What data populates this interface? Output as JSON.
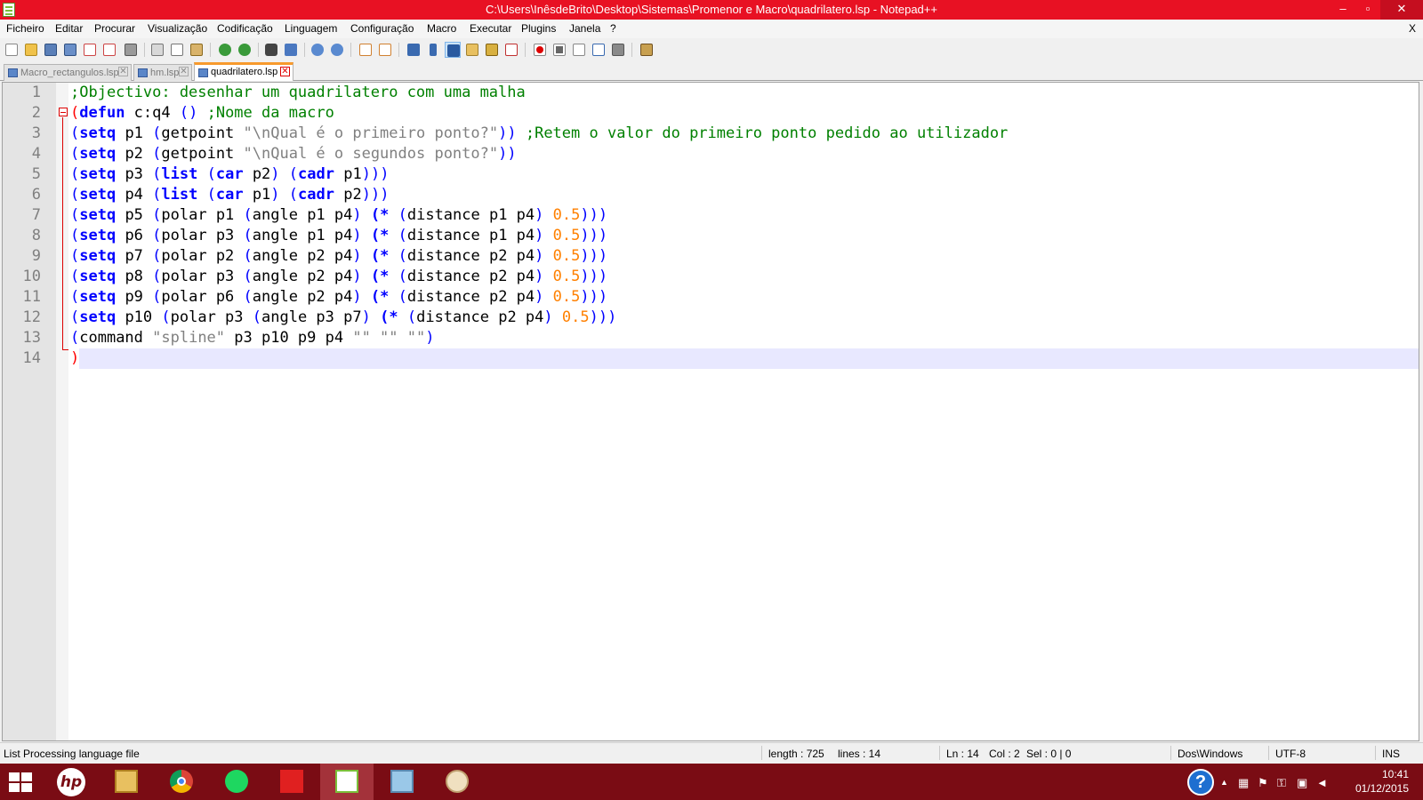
{
  "window": {
    "title": "C:\\Users\\InêsdeBrito\\Desktop\\Sistemas\\Promenor e Macro\\quadrilatero.lsp - Notepad++",
    "minimize_glyph": "–",
    "maximize_glyph": "▫",
    "close_glyph": "✕",
    "menu_close": "X"
  },
  "menu": {
    "items": [
      "Ficheiro",
      "Editar",
      "Procurar",
      "Visualização",
      "Codificação",
      "Linguagem",
      "Configuração",
      "Macro",
      "Executar",
      "Plugins",
      "Janela",
      "?"
    ]
  },
  "toolbar": {
    "icons": [
      "new-file-icon",
      "open-file-icon",
      "save-icon",
      "save-all-icon",
      "close-icon",
      "close-all-icon",
      "print-icon",
      "cut-icon",
      "copy-icon",
      "paste-icon",
      "undo-icon",
      "redo-icon",
      "find-icon",
      "replace-icon",
      "zoom-in-icon",
      "zoom-out-icon",
      "sync-vertical-icon",
      "sync-horizontal-icon",
      "word-wrap-icon",
      "show-all-chars-icon",
      "indent-guide-icon",
      "doc-map-icon",
      "function-list-icon",
      "folder-workspace-icon",
      "record-macro-icon",
      "stop-record-icon",
      "play-macro-icon",
      "run-macro-multiple-icon",
      "save-macro-icon",
      "launch-browser-icon"
    ]
  },
  "tabs": [
    {
      "label": "Macro_rectangulos.lsp",
      "close": "✕",
      "active": false
    },
    {
      "label": "hm.lsp",
      "close": "✕",
      "active": false
    },
    {
      "label": "quadrilatero.lsp",
      "close": "✕",
      "active": true
    }
  ],
  "editor": {
    "line_numbers": [
      "1",
      "2",
      "3",
      "4",
      "5",
      "6",
      "7",
      "8",
      "9",
      "10",
      "11",
      "12",
      "13",
      "14"
    ],
    "lines": [
      [
        {
          "t": ";Objectivo: desenhar um quadrilatero com uma malha",
          "c": "cm"
        }
      ],
      [
        {
          "t": "(",
          "c": "rd"
        },
        {
          "t": "defun",
          "c": "kw"
        },
        {
          "t": " c:q4 ",
          "c": ""
        },
        {
          "t": "()",
          "c": "pn"
        },
        {
          "t": " ",
          "c": ""
        },
        {
          "t": ";Nome da macro",
          "c": "cm"
        }
      ],
      [
        {
          "t": "(",
          "c": "pn"
        },
        {
          "t": "setq",
          "c": "kw"
        },
        {
          "t": " p1 ",
          "c": ""
        },
        {
          "t": "(",
          "c": "pn"
        },
        {
          "t": "getpoint ",
          "c": ""
        },
        {
          "t": "\"\\nQual é o primeiro ponto?\"",
          "c": "st"
        },
        {
          "t": "))",
          "c": "pn"
        },
        {
          "t": " ",
          "c": ""
        },
        {
          "t": ";Retem o valor do primeiro ponto pedido ao utilizador",
          "c": "cm"
        }
      ],
      [
        {
          "t": "(",
          "c": "pn"
        },
        {
          "t": "setq",
          "c": "kw"
        },
        {
          "t": " p2 ",
          "c": ""
        },
        {
          "t": "(",
          "c": "pn"
        },
        {
          "t": "getpoint ",
          "c": ""
        },
        {
          "t": "\"\\nQual é o segundos ponto?\"",
          "c": "st"
        },
        {
          "t": "))",
          "c": "pn"
        }
      ],
      [
        {
          "t": "(",
          "c": "pn"
        },
        {
          "t": "setq",
          "c": "kw"
        },
        {
          "t": " p3 ",
          "c": ""
        },
        {
          "t": "(",
          "c": "pn"
        },
        {
          "t": "list",
          "c": "kw"
        },
        {
          "t": " ",
          "c": ""
        },
        {
          "t": "(",
          "c": "pn"
        },
        {
          "t": "car",
          "c": "kw"
        },
        {
          "t": " p2",
          "c": ""
        },
        {
          "t": ")",
          "c": "pn"
        },
        {
          "t": " ",
          "c": ""
        },
        {
          "t": "(",
          "c": "pn"
        },
        {
          "t": "cadr",
          "c": "kw"
        },
        {
          "t": " p1",
          "c": ""
        },
        {
          "t": ")))",
          "c": "pn"
        }
      ],
      [
        {
          "t": "(",
          "c": "pn"
        },
        {
          "t": "setq",
          "c": "kw"
        },
        {
          "t": " p4 ",
          "c": ""
        },
        {
          "t": "(",
          "c": "pn"
        },
        {
          "t": "list",
          "c": "kw"
        },
        {
          "t": " ",
          "c": ""
        },
        {
          "t": "(",
          "c": "pn"
        },
        {
          "t": "car",
          "c": "kw"
        },
        {
          "t": " p1",
          "c": ""
        },
        {
          "t": ")",
          "c": "pn"
        },
        {
          "t": " ",
          "c": ""
        },
        {
          "t": "(",
          "c": "pn"
        },
        {
          "t": "cadr",
          "c": "kw"
        },
        {
          "t": " p2",
          "c": ""
        },
        {
          "t": ")))",
          "c": "pn"
        }
      ],
      [
        {
          "t": "(",
          "c": "pn"
        },
        {
          "t": "setq",
          "c": "kw"
        },
        {
          "t": " p5 ",
          "c": ""
        },
        {
          "t": "(",
          "c": "pn"
        },
        {
          "t": "polar p1 ",
          "c": ""
        },
        {
          "t": "(",
          "c": "pn"
        },
        {
          "t": "angle p1 p4",
          "c": ""
        },
        {
          "t": ")",
          "c": "pn"
        },
        {
          "t": " ",
          "c": ""
        },
        {
          "t": "(*",
          "c": "kw"
        },
        {
          "t": " ",
          "c": ""
        },
        {
          "t": "(",
          "c": "pn"
        },
        {
          "t": "distance p1 p4",
          "c": ""
        },
        {
          "t": ")",
          "c": "pn"
        },
        {
          "t": " ",
          "c": ""
        },
        {
          "t": "0.5",
          "c": "nm"
        },
        {
          "t": ")))",
          "c": "pn"
        }
      ],
      [
        {
          "t": "(",
          "c": "pn"
        },
        {
          "t": "setq",
          "c": "kw"
        },
        {
          "t": " p6 ",
          "c": ""
        },
        {
          "t": "(",
          "c": "pn"
        },
        {
          "t": "polar p3 ",
          "c": ""
        },
        {
          "t": "(",
          "c": "pn"
        },
        {
          "t": "angle p1 p4",
          "c": ""
        },
        {
          "t": ")",
          "c": "pn"
        },
        {
          "t": " ",
          "c": ""
        },
        {
          "t": "(*",
          "c": "kw"
        },
        {
          "t": " ",
          "c": ""
        },
        {
          "t": "(",
          "c": "pn"
        },
        {
          "t": "distance p1 p4",
          "c": ""
        },
        {
          "t": ")",
          "c": "pn"
        },
        {
          "t": " ",
          "c": ""
        },
        {
          "t": "0.5",
          "c": "nm"
        },
        {
          "t": ")))",
          "c": "pn"
        }
      ],
      [
        {
          "t": "(",
          "c": "pn"
        },
        {
          "t": "setq",
          "c": "kw"
        },
        {
          "t": " p7 ",
          "c": ""
        },
        {
          "t": "(",
          "c": "pn"
        },
        {
          "t": "polar p2 ",
          "c": ""
        },
        {
          "t": "(",
          "c": "pn"
        },
        {
          "t": "angle p2 p4",
          "c": ""
        },
        {
          "t": ")",
          "c": "pn"
        },
        {
          "t": " ",
          "c": ""
        },
        {
          "t": "(*",
          "c": "kw"
        },
        {
          "t": " ",
          "c": ""
        },
        {
          "t": "(",
          "c": "pn"
        },
        {
          "t": "distance p2 p4",
          "c": ""
        },
        {
          "t": ")",
          "c": "pn"
        },
        {
          "t": " ",
          "c": ""
        },
        {
          "t": "0.5",
          "c": "nm"
        },
        {
          "t": ")))",
          "c": "pn"
        }
      ],
      [
        {
          "t": "(",
          "c": "pn"
        },
        {
          "t": "setq",
          "c": "kw"
        },
        {
          "t": " p8 ",
          "c": ""
        },
        {
          "t": "(",
          "c": "pn"
        },
        {
          "t": "polar p3 ",
          "c": ""
        },
        {
          "t": "(",
          "c": "pn"
        },
        {
          "t": "angle p2 p4",
          "c": ""
        },
        {
          "t": ")",
          "c": "pn"
        },
        {
          "t": " ",
          "c": ""
        },
        {
          "t": "(*",
          "c": "kw"
        },
        {
          "t": " ",
          "c": ""
        },
        {
          "t": "(",
          "c": "pn"
        },
        {
          "t": "distance p2 p4",
          "c": ""
        },
        {
          "t": ")",
          "c": "pn"
        },
        {
          "t": " ",
          "c": ""
        },
        {
          "t": "0.5",
          "c": "nm"
        },
        {
          "t": ")))",
          "c": "pn"
        }
      ],
      [
        {
          "t": "(",
          "c": "pn"
        },
        {
          "t": "setq",
          "c": "kw"
        },
        {
          "t": " p9 ",
          "c": ""
        },
        {
          "t": "(",
          "c": "pn"
        },
        {
          "t": "polar p6 ",
          "c": ""
        },
        {
          "t": "(",
          "c": "pn"
        },
        {
          "t": "angle p2 p4",
          "c": ""
        },
        {
          "t": ")",
          "c": "pn"
        },
        {
          "t": " ",
          "c": ""
        },
        {
          "t": "(*",
          "c": "kw"
        },
        {
          "t": " ",
          "c": ""
        },
        {
          "t": "(",
          "c": "pn"
        },
        {
          "t": "distance p2 p4",
          "c": ""
        },
        {
          "t": ")",
          "c": "pn"
        },
        {
          "t": " ",
          "c": ""
        },
        {
          "t": "0.5",
          "c": "nm"
        },
        {
          "t": ")))",
          "c": "pn"
        }
      ],
      [
        {
          "t": "(",
          "c": "pn"
        },
        {
          "t": "setq",
          "c": "kw"
        },
        {
          "t": " p10 ",
          "c": ""
        },
        {
          "t": "(",
          "c": "pn"
        },
        {
          "t": "polar p3 ",
          "c": ""
        },
        {
          "t": "(",
          "c": "pn"
        },
        {
          "t": "angle p3 p7",
          "c": ""
        },
        {
          "t": ")",
          "c": "pn"
        },
        {
          "t": " ",
          "c": ""
        },
        {
          "t": "(*",
          "c": "kw"
        },
        {
          "t": " ",
          "c": ""
        },
        {
          "t": "(",
          "c": "pn"
        },
        {
          "t": "distance p2 p4",
          "c": ""
        },
        {
          "t": ")",
          "c": "pn"
        },
        {
          "t": " ",
          "c": ""
        },
        {
          "t": "0.5",
          "c": "nm"
        },
        {
          "t": ")))",
          "c": "pn"
        }
      ],
      [
        {
          "t": "(",
          "c": "pn"
        },
        {
          "t": "command ",
          "c": ""
        },
        {
          "t": "\"spline\"",
          "c": "st"
        },
        {
          "t": " p3 p10 p9 p4 ",
          "c": ""
        },
        {
          "t": "\"\" \"\" \"\"",
          "c": "st"
        },
        {
          "t": ")",
          "c": "pn"
        }
      ],
      [
        {
          "t": ")",
          "c": "rd"
        }
      ]
    ]
  },
  "status": {
    "file_type": "List Processing language file",
    "length": "length : 725",
    "lines": "lines : 14",
    "ln": "Ln : 14",
    "col": "Col : 2",
    "sel": "Sel : 0 | 0",
    "eol": "Dos\\Windows",
    "encoding": "UTF-8",
    "mode": "INS"
  },
  "taskbar": {
    "hp_logo_text": "hp",
    "apps": [
      "file-explorer-icon",
      "chrome-icon",
      "spotify-icon",
      "autocad-icon",
      "notepadpp-icon",
      "notepad-icon",
      "paint-icon"
    ],
    "help_glyph": "?",
    "tray_glyphs": [
      "▲",
      "▦",
      "⚑",
      "⚿",
      "▣",
      "◄"
    ],
    "time": "10:41",
    "date": "01/12/2015"
  },
  "colors": {
    "titlebar": "#e81123",
    "taskbar": "#7a0c14",
    "comment": "#008000",
    "keyword": "#0000ff",
    "string": "#808080",
    "number": "#ff8000",
    "current_line": "#e8e8ff"
  }
}
